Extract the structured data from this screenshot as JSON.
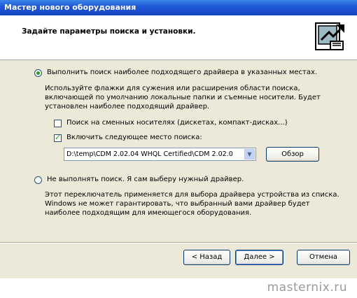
{
  "window": {
    "title": "Мастер нового оборудования"
  },
  "header": {
    "title": "Задайте параметры поиска и установки.",
    "icon": "hardware-wizard-icon"
  },
  "options": {
    "search": {
      "label": "Выполнить поиск наиболее подходящего драйвера в указанных местах.",
      "selected": true,
      "description": "Используйте флажки для сужения или расширения области поиска, включающей по умолчанию локальные папки и съемные носители. Будет установлен наиболее подходящий драйвер.",
      "removable_media": {
        "label": "Поиск на сменных носителях (дискетах, компакт-дисках...)",
        "checked": false
      },
      "include_location": {
        "label": "Включить следующее место поиска:",
        "checked": true
      },
      "path_value": "D:\\temp\\CDM 2.02.04 WHQL Certified\\CDM 2.02.0",
      "browse_label": "Обзор"
    },
    "manual": {
      "label": "Не выполнять поиск. Я сам выберу нужный драйвер.",
      "selected": false,
      "description": "Этот переключатель применяется для выбора драйвера устройства из списка. Windows не может гарантировать, что выбранный вами драйвер будет наиболее подходящим для имеющегося оборудования."
    }
  },
  "footer": {
    "back_label": "< Назад",
    "next_label": "Далее >",
    "cancel_label": "Отмена"
  },
  "watermark": "masternix.ru",
  "colors": {
    "titlebar": "#1d55d6",
    "dialog_bg": "#ece9d8",
    "check_green": "#21a121"
  }
}
